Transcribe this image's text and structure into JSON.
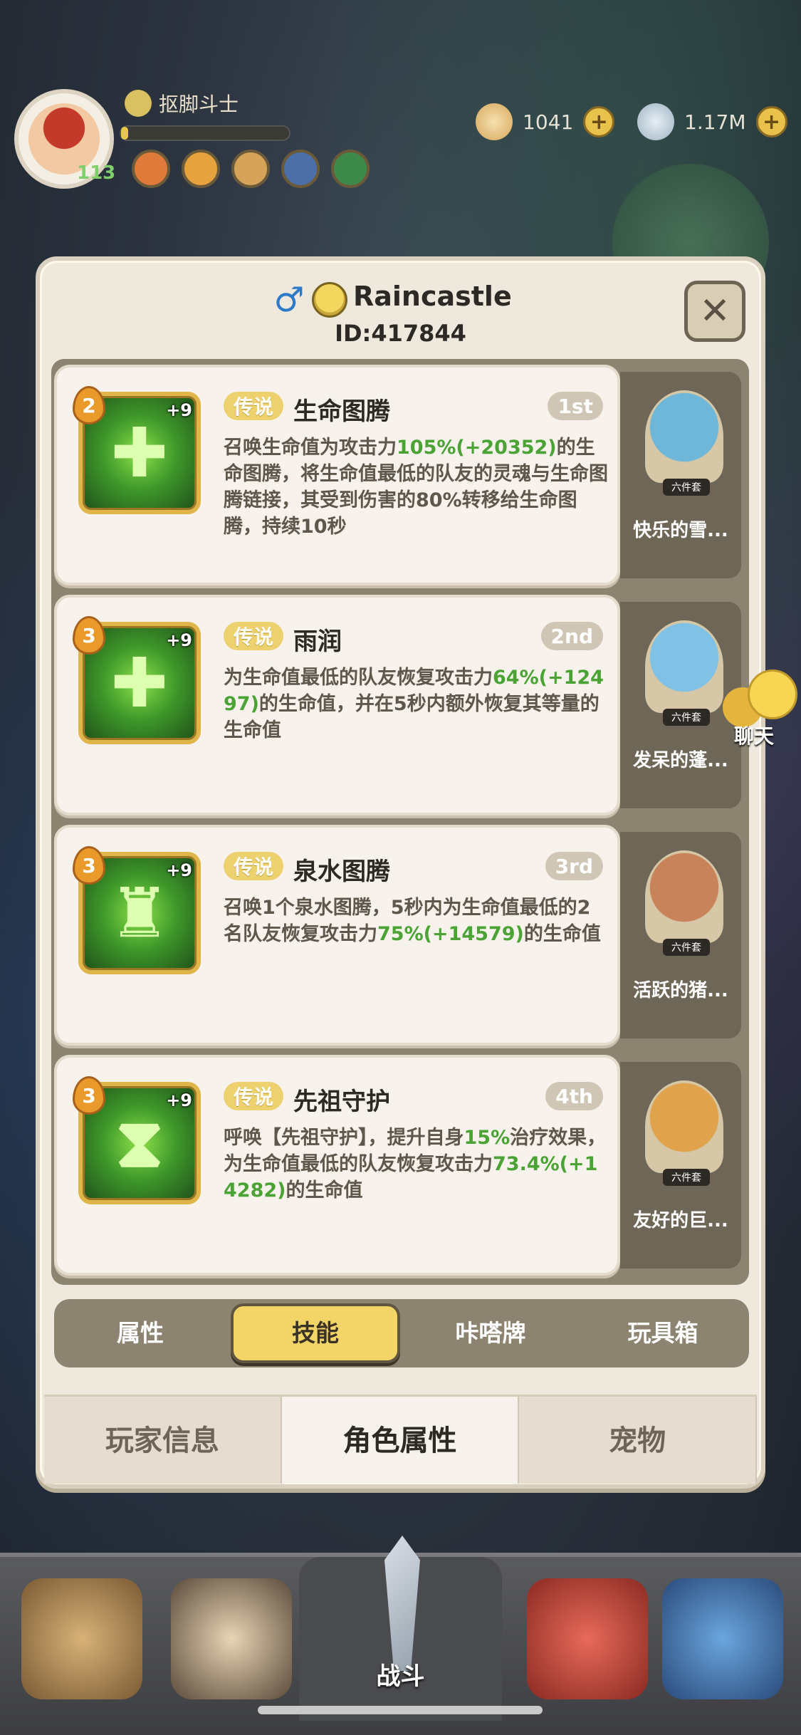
{
  "hud": {
    "username": "抠脚斗士",
    "level": "113",
    "currency1": "1041",
    "currency2": "1.17M",
    "plus_symbol": "+"
  },
  "profile": {
    "name": "Raincastle",
    "id_text": "ID:417844",
    "gender_symbol": "♂",
    "close_symbol": "✕"
  },
  "skills": [
    {
      "level": "2",
      "plus": "+9",
      "rarity": "传说",
      "name": "生命图腾",
      "rank": "1st",
      "desc_parts": [
        "召唤生命值为攻击力",
        "105%(+20352)",
        "的生命图腾，将生命值最低的队友的灵魂与生命图腾链接，其受到伤害的80%转移给生命图腾，持续10秒"
      ],
      "icon": "plus-totem-icon",
      "pet_name": "快乐的雪...",
      "pet_tag": "六件套",
      "pet_color": "#6fb7d8"
    },
    {
      "level": "3",
      "plus": "+9",
      "rarity": "传说",
      "name": "雨润",
      "rank": "2nd",
      "desc_parts": [
        "为生命值最低的队友恢复攻击力",
        "64%(+12497)",
        "的生命值，并在5秒内额外恢复其等量的生命值"
      ],
      "icon": "heal-cross-icon",
      "pet_name": "发呆的蓬...",
      "pet_tag": "六件套",
      "pet_color": "#7fc2e6"
    },
    {
      "level": "3",
      "plus": "+9",
      "rarity": "传说",
      "name": "泉水图腾",
      "rank": "3rd",
      "desc_parts": [
        "召唤1个泉水图腾，5秒内为生命值最低的2名队友恢复攻击力",
        "75%(+14579)",
        "的生命值"
      ],
      "icon": "fountain-totem-icon",
      "pet_name": "活跃的猪...",
      "pet_tag": "六件套",
      "pet_color": "#c8835a"
    },
    {
      "level": "3",
      "plus": "+9",
      "rarity": "传说",
      "name": "先祖守护",
      "rank": "4th",
      "desc_parts": [
        "呼唤【先祖守护】，提升自身",
        "15%",
        "治疗效果，为生命值最低的队友恢复攻击力",
        "73.4%(+14282)",
        "的生命值"
      ],
      "icon": "ancestor-guard-icon",
      "pet_name": "友好的巨...",
      "pet_tag": "六件套",
      "pet_color": "#e0a24a"
    }
  ],
  "sub_tabs": [
    "属性",
    "技能",
    "咔嗒牌",
    "玩具箱"
  ],
  "sub_tab_active": 1,
  "main_tabs": [
    "玩家信息",
    "角色属性",
    "宠物"
  ],
  "main_tab_active": 1,
  "chat_label": "聊天",
  "nav": {
    "battle_label": "战斗"
  }
}
